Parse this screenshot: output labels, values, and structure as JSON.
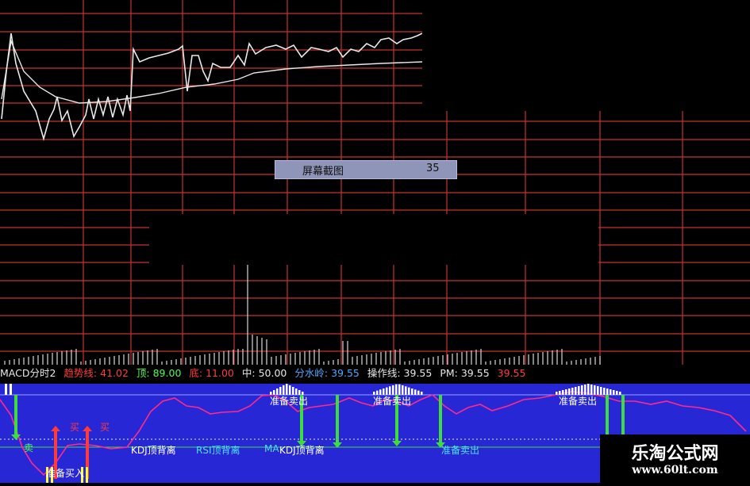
{
  "dialog": {
    "title": "屏幕截图",
    "value": "35"
  },
  "indicator": {
    "name": "MACD分时2",
    "trend_label": "趋势线:",
    "trend_value": "41.02",
    "top_label": "顶:",
    "top_value": "89.00",
    "bottom_label": "底:",
    "bottom_value": "11.00",
    "mid_label": "中:",
    "mid_value": "50.00",
    "ridge_label": "分水岭:",
    "ridge_value": "39.55",
    "op_label": "操作线:",
    "op_value": "39.55",
    "pm_label": "PM:",
    "pm_value": "39.55",
    "extra_value": "39.55"
  },
  "signals": {
    "sell_prepare": "准备卖出",
    "buy_prepare": "准备买入",
    "buy": "买",
    "sell": "卖",
    "kdj_top_div": "KDJ顶背离",
    "kdj_top_div_partial": "KDJ顶背离",
    "rsi_top_div": "RSI顶背离",
    "macd_partial": "MA",
    "fall_partial": "准备卖出"
  },
  "watermark": {
    "title": "乐淘公式网",
    "url": "www.60lt.com"
  },
  "colors": {
    "red_grid": "#c83232",
    "blue_panel": "#2727d6",
    "pink_line": "#ff2a8c",
    "green_arrow": "#3fdc3f",
    "yellow": "#ffff33",
    "cyan": "#4fe0ff"
  }
}
